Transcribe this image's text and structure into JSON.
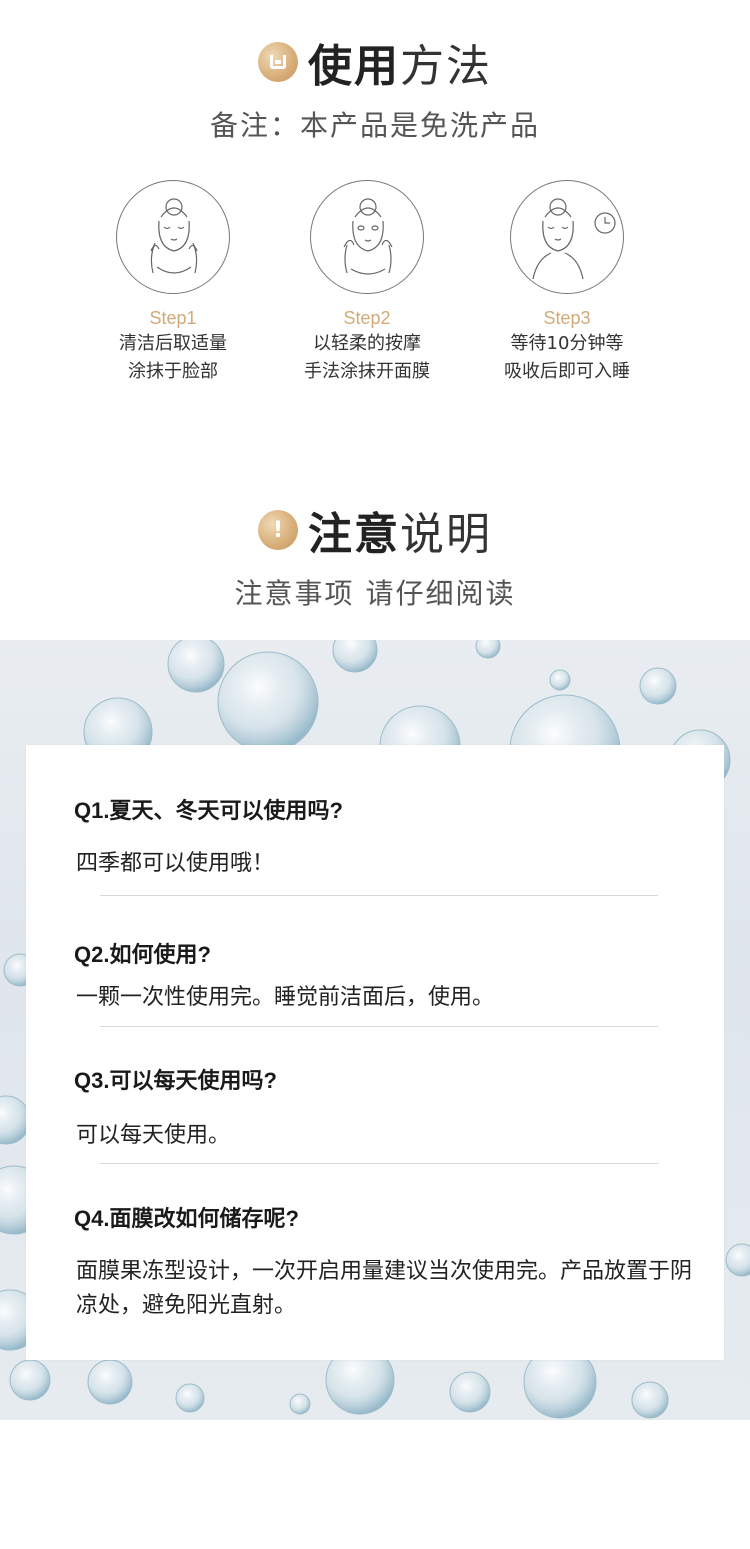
{
  "usage": {
    "title_bold": "使用",
    "title_light": "方法",
    "note": "备注：本产品是免洗产品",
    "steps": [
      {
        "label": "Step1",
        "line1": "清洁后取适量",
        "line2": "涂抹于脸部"
      },
      {
        "label": "Step2",
        "line1": "以轻柔的按摩",
        "line2": "手法涂抹开面膜"
      },
      {
        "label": "Step3",
        "line1": "等待10分钟等",
        "line2": "吸收后即可入睡"
      }
    ]
  },
  "notice": {
    "badge": "!",
    "title_bold": "注意",
    "title_light": "说明",
    "subtitle": "注意事项 请仔细阅读"
  },
  "faq": [
    {
      "q": "Q1.夏天、冬天可以使用吗?",
      "a": "四季都可以使用哦！"
    },
    {
      "q": "Q2.如何使用?",
      "a": "一颗一次性使用完。睡觉前洁面后，使用。"
    },
    {
      "q": "Q3.可以每天使用吗?",
      "a": "可以每天使用。"
    },
    {
      "q": "Q4.面膜改如何储存呢?",
      "a": "面膜果冻型设计，一次开启用量建议当次使用完。产品放置于阴凉处，避免阳光直射。"
    }
  ],
  "colors": {
    "accent_gold": "#d2a978",
    "badge_gold": "#d9b07c",
    "bubble_blue": "#a9c7d6"
  }
}
